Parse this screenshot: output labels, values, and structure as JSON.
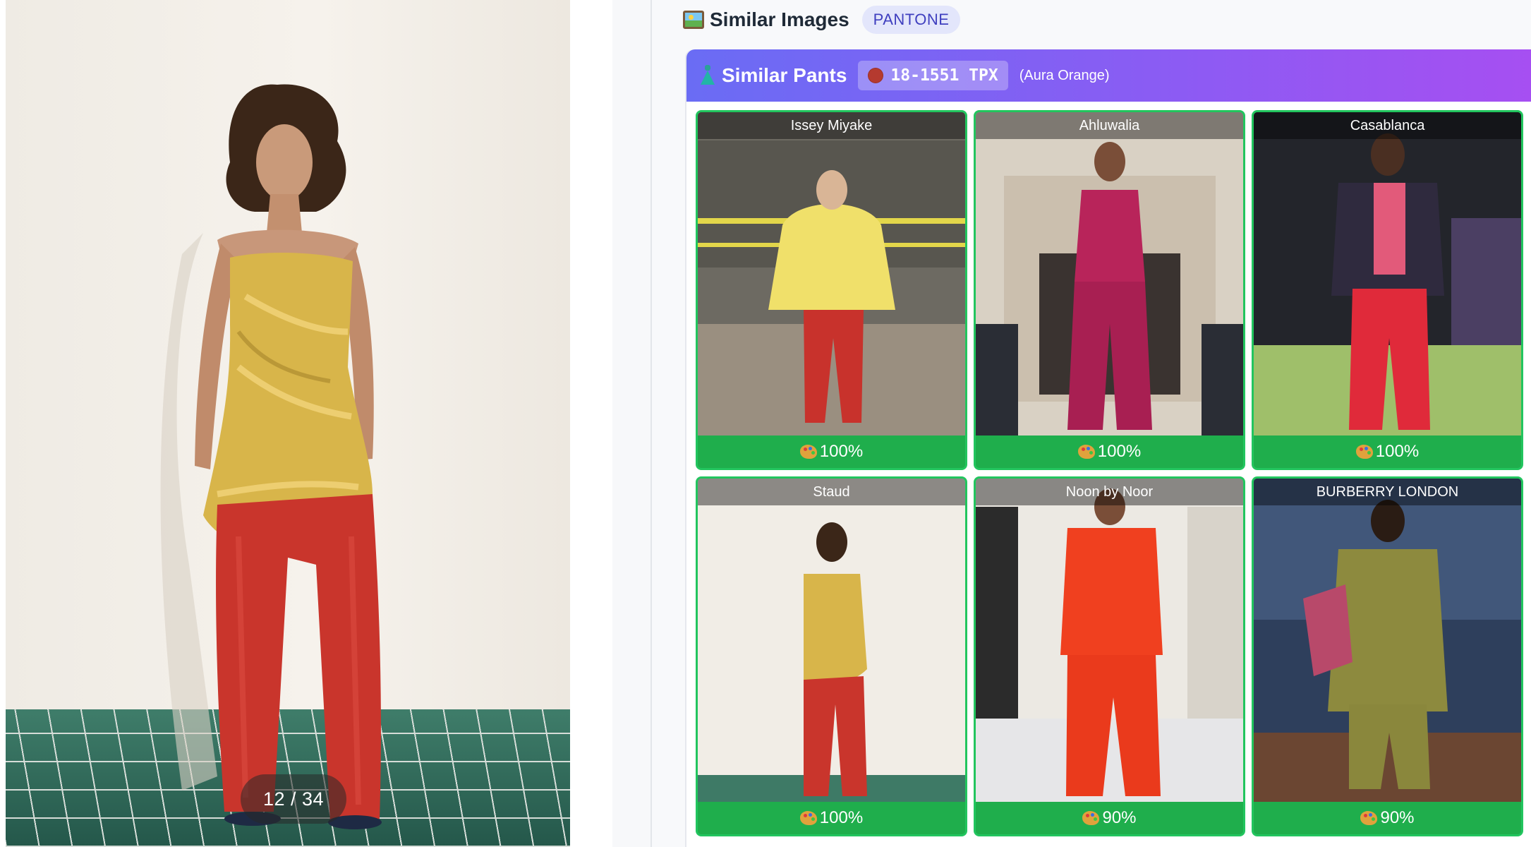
{
  "viewer": {
    "counter": "12 / 34"
  },
  "similar": {
    "title": "Similar Images",
    "icon": "framed-picture-icon",
    "badge": "PANTONE"
  },
  "card": {
    "title": "Similar Pants",
    "icon": "dress-icon",
    "pantone_code": "18-1551 TPX",
    "pantone_color_hex": "#b53a2f",
    "pantone_name": "(Aura Orange)",
    "header_gradient": [
      "#6a6cf4",
      "#a64ff2"
    ],
    "match_border_color": "#22c55e"
  },
  "results": [
    {
      "brand": "Issey Miyake",
      "score": "100%"
    },
    {
      "brand": "Ahluwalia",
      "score": "100%"
    },
    {
      "brand": "Casablanca",
      "score": "100%"
    },
    {
      "brand": "Staud",
      "score": "100%"
    },
    {
      "brand": "Noon by Noor",
      "score": "90%"
    },
    {
      "brand": "BURBERRY LONDON",
      "score": "90%"
    }
  ]
}
